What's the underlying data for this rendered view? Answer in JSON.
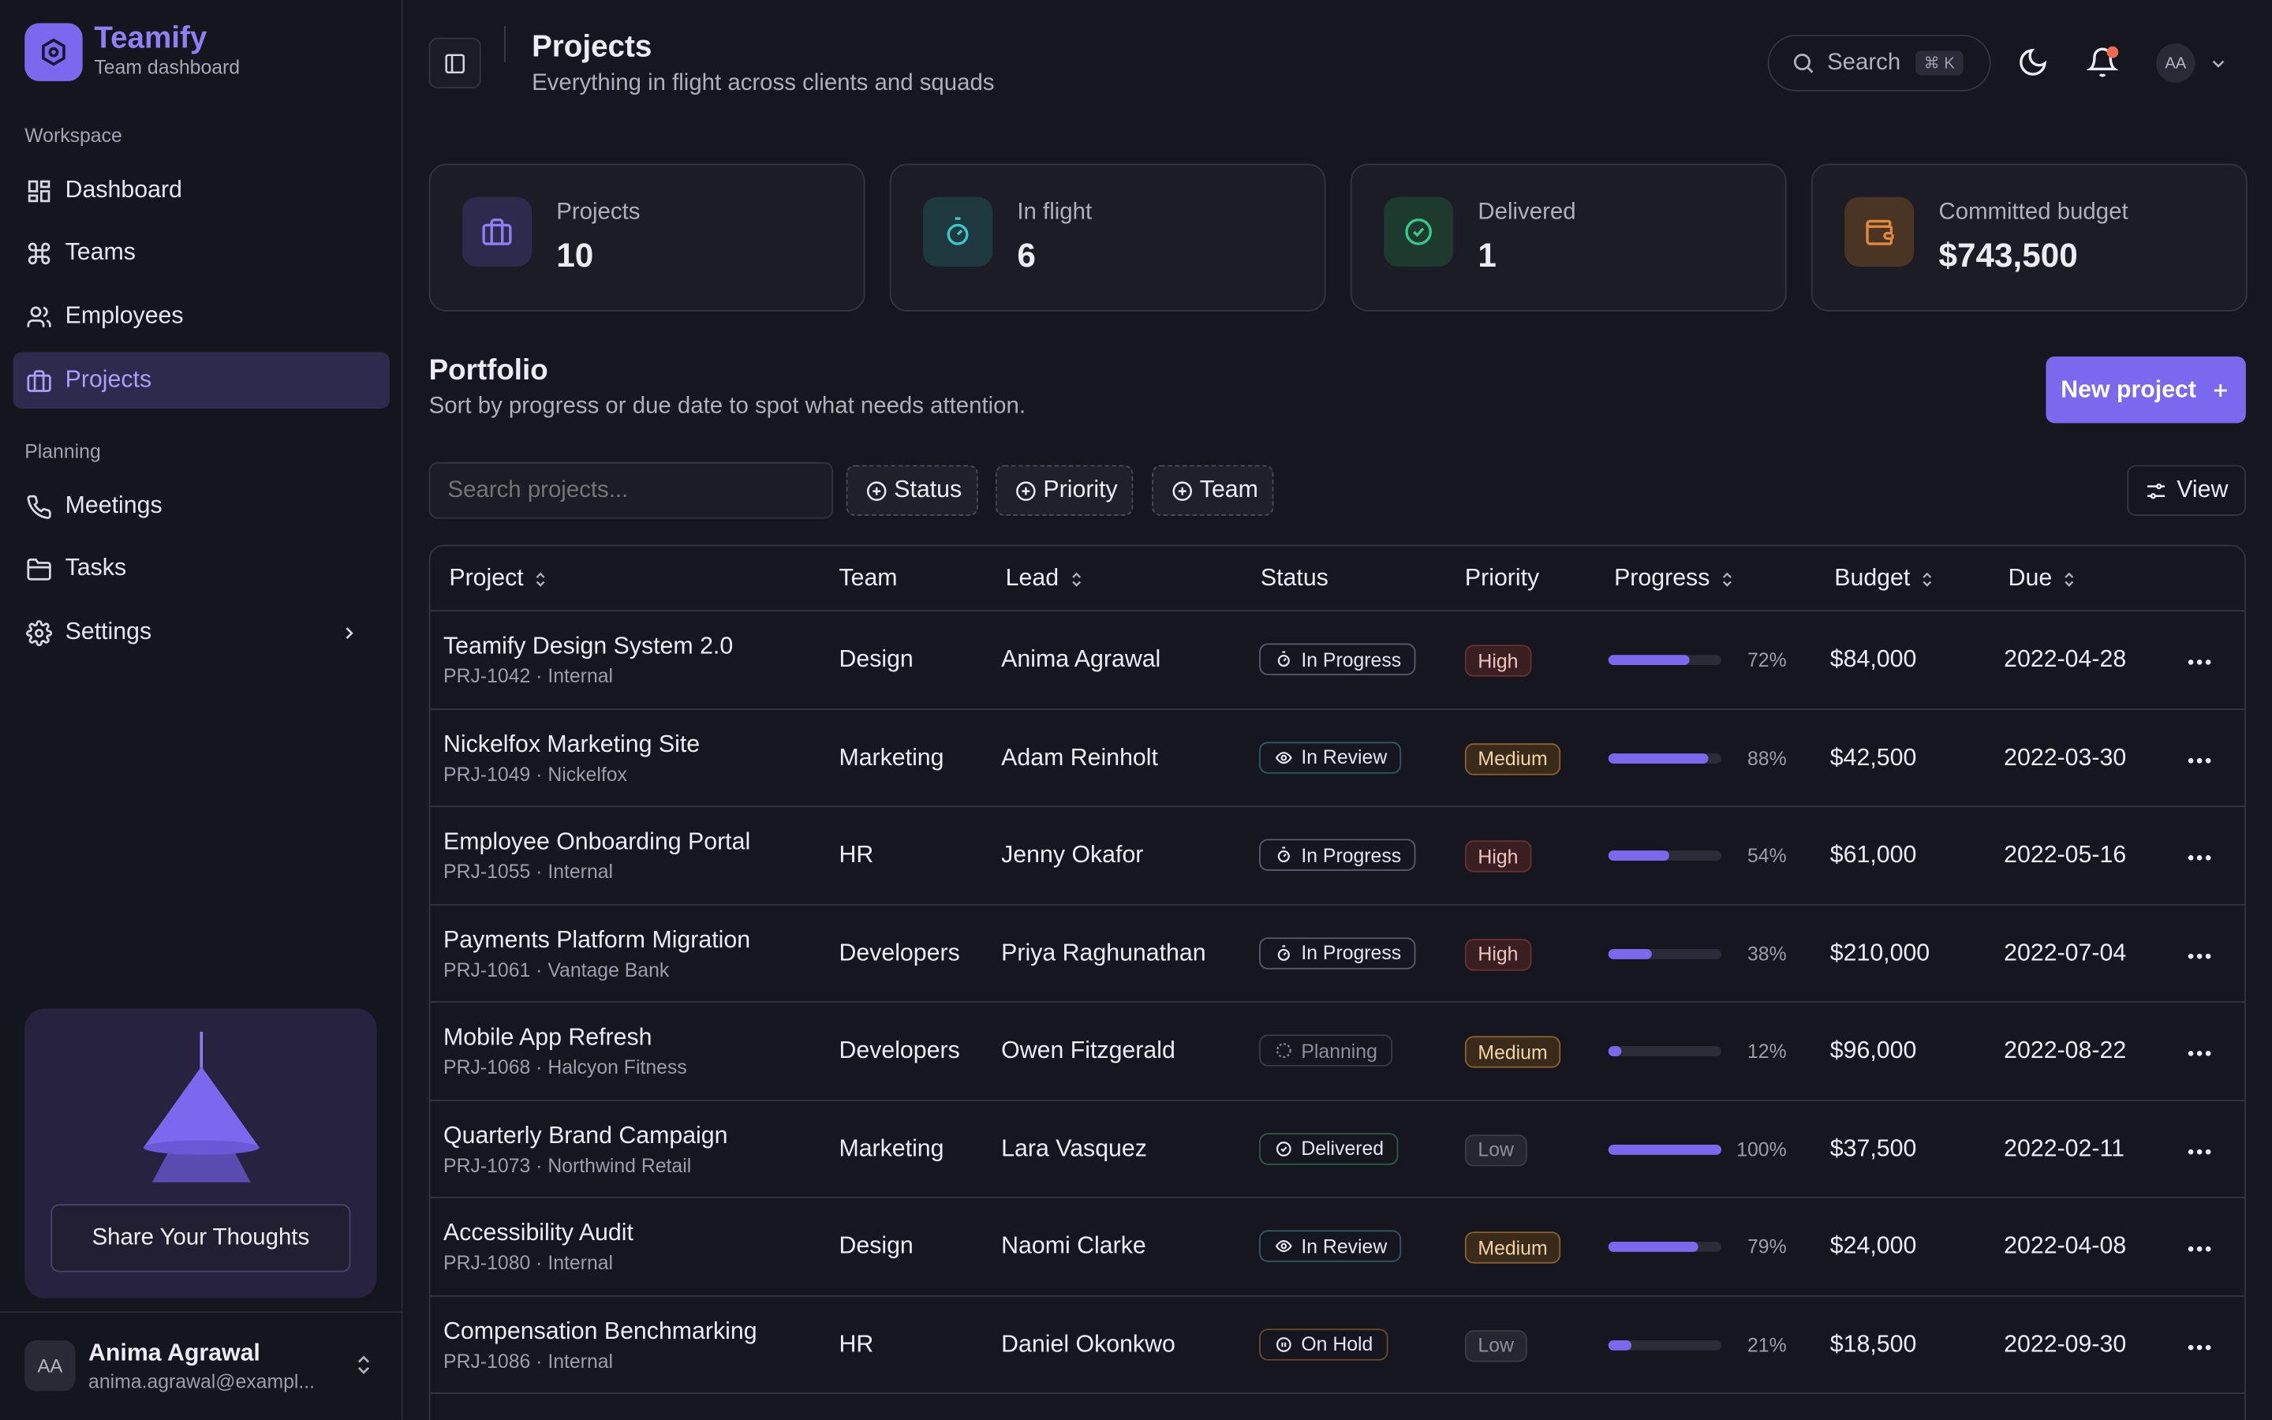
{
  "brand": {
    "name": "Teamify",
    "subtitle": "Team dashboard"
  },
  "sidebar": {
    "sections": [
      "Workspace",
      "Planning"
    ],
    "items": [
      {
        "label": "Dashboard",
        "icon": "grid-icon"
      },
      {
        "label": "Teams",
        "icon": "command-icon"
      },
      {
        "label": "Employees",
        "icon": "users-icon"
      },
      {
        "label": "Projects",
        "icon": "briefcase-icon",
        "active": true
      },
      {
        "label": "Meetings",
        "icon": "phone-icon"
      },
      {
        "label": "Tasks",
        "icon": "folder-icon"
      },
      {
        "label": "Settings",
        "icon": "gear-icon"
      }
    ],
    "promo_button": "Share Your Thoughts",
    "user": {
      "initials": "AA",
      "name": "Anima Agrawal",
      "email": "anima.agrawal@exampl..."
    }
  },
  "header": {
    "title": "Projects",
    "subtitle": "Everything in flight across clients and squads",
    "search_label": "Search",
    "search_kbd": "⌘ K",
    "avatar": "AA"
  },
  "stats": [
    {
      "label": "Projects",
      "value": "10",
      "color": "#7b68ee"
    },
    {
      "label": "In flight",
      "value": "6",
      "color": "#3fc7c7"
    },
    {
      "label": "Delivered",
      "value": "1",
      "color": "#37c98a"
    },
    {
      "label": "Committed budget",
      "value": "$743,500",
      "color": "#e08a3a"
    }
  ],
  "portfolio": {
    "title": "Portfolio",
    "subtitle": "Sort by progress or due date to spot what needs attention.",
    "new_button": "New project",
    "search_placeholder": "Search projects...",
    "filters": [
      "Status",
      "Priority",
      "Team"
    ],
    "view_button": "View"
  },
  "table": {
    "columns": [
      "Project",
      "Team",
      "Lead",
      "Status",
      "Priority",
      "Progress",
      "Budget",
      "Due"
    ],
    "rows": [
      {
        "name": "Teamify Design System 2.0",
        "meta": "PRJ-1042 · Internal",
        "team": "Design",
        "lead": "Anima Agrawal",
        "status": "In Progress",
        "priority": "High",
        "progress": 72,
        "progress_label": "72%",
        "budget": "$84,000",
        "due": "2022-04-28"
      },
      {
        "name": "Nickelfox Marketing Site",
        "meta": "PRJ-1049 · Nickelfox",
        "team": "Marketing",
        "lead": "Adam Reinholt",
        "status": "In Review",
        "priority": "Medium",
        "progress": 88,
        "progress_label": "88%",
        "budget": "$42,500",
        "due": "2022-03-30"
      },
      {
        "name": "Employee Onboarding Portal",
        "meta": "PRJ-1055 · Internal",
        "team": "HR",
        "lead": "Jenny Okafor",
        "status": "In Progress",
        "priority": "High",
        "progress": 54,
        "progress_label": "54%",
        "budget": "$61,000",
        "due": "2022-05-16"
      },
      {
        "name": "Payments Platform Migration",
        "meta": "PRJ-1061 · Vantage Bank",
        "team": "Developers",
        "lead": "Priya Raghunathan",
        "status": "In Progress",
        "priority": "High",
        "progress": 38,
        "progress_label": "38%",
        "budget": "$210,000",
        "due": "2022-07-04"
      },
      {
        "name": "Mobile App Refresh",
        "meta": "PRJ-1068 · Halcyon Fitness",
        "team": "Developers",
        "lead": "Owen Fitzgerald",
        "status": "Planning",
        "priority": "Medium",
        "progress": 12,
        "progress_label": "12%",
        "budget": "$96,000",
        "due": "2022-08-22"
      },
      {
        "name": "Quarterly Brand Campaign",
        "meta": "PRJ-1073 · Northwind Retail",
        "team": "Marketing",
        "lead": "Lara Vasquez",
        "status": "Delivered",
        "priority": "Low",
        "progress": 100,
        "progress_label": "100%",
        "budget": "$37,500",
        "due": "2022-02-11"
      },
      {
        "name": "Accessibility Audit",
        "meta": "PRJ-1080 · Internal",
        "team": "Design",
        "lead": "Naomi Clarke",
        "status": "In Review",
        "priority": "Medium",
        "progress": 79,
        "progress_label": "79%",
        "budget": "$24,000",
        "due": "2022-04-08"
      },
      {
        "name": "Compensation Benchmarking",
        "meta": "PRJ-1086 · Internal",
        "team": "HR",
        "lead": "Daniel Okonkwo",
        "status": "On Hold",
        "priority": "Low",
        "progress": 21,
        "progress_label": "21%",
        "budget": "$18,500",
        "due": "2022-09-30"
      }
    ]
  }
}
